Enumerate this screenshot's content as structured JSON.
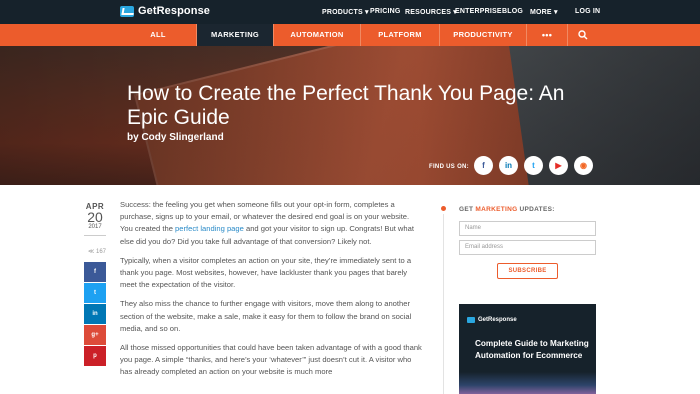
{
  "topbar": {
    "brand": "GetResponse",
    "links": [
      "PRODUCTS ▾",
      "PRICING",
      "RESOURCES ▾",
      "ENTERPRISE",
      "BLOG",
      "MORE ▾"
    ],
    "login": "LOG IN"
  },
  "mainnav": {
    "items": [
      "ALL",
      "MARKETING",
      "AUTOMATION",
      "PLATFORM",
      "PRODUCTIVITY",
      "•••"
    ],
    "active": "MARKETING"
  },
  "hero": {
    "title": "How to Create the Perfect Thank You Page: An Epic Guide",
    "author": "by Cody Slingerland",
    "find_us": "FIND US ON:",
    "social": [
      {
        "icon": "facebook-icon",
        "glyph": "f",
        "color": "#3b5998"
      },
      {
        "icon": "linkedin-icon",
        "glyph": "in",
        "color": "#0077b5"
      },
      {
        "icon": "twitter-icon",
        "glyph": "t",
        "color": "#1da1f2"
      },
      {
        "icon": "youtube-icon",
        "glyph": "▶",
        "color": "#e52d27"
      },
      {
        "icon": "rss-icon",
        "glyph": "◉",
        "color": "#f26522"
      }
    ]
  },
  "post": {
    "month": "APR",
    "day": "20",
    "year": "2017",
    "share_count": "≪ 167",
    "share_buttons": [
      {
        "icon": "facebook-icon",
        "glyph": "f",
        "color": "#3b5998"
      },
      {
        "icon": "twitter-icon",
        "glyph": "t",
        "color": "#1da1f2"
      },
      {
        "icon": "linkedin-icon",
        "glyph": "in",
        "color": "#0077b5"
      },
      {
        "icon": "google-plus-icon",
        "glyph": "g+",
        "color": "#dd4b39"
      },
      {
        "icon": "pinterest-icon",
        "glyph": "p",
        "color": "#cb2027"
      }
    ],
    "p1_a": "Success: the feeling you get when someone fills out your opt-in form, completes a purchase, signs up to your email, or whatever the desired end goal is on your website. You created the ",
    "p1_link": "perfect landing page",
    "p1_b": " and got your visitor to sign up. Congrats! But what else did you do? Did you take full advantage of that conversion? Likely not.",
    "p2": "Typically, when a visitor completes an action on your site, they’re immediately sent to a thank you page. Most websites, however, have lackluster thank you pages that barely meet the expectation of the visitor.",
    "p3": "They also miss the chance to further engage with visitors, move them along to another section of the website, make a sale, make it easy for them to follow the brand on social media, and so on.",
    "p4": "All those missed opportunities that could have been taken advantage of with a good thank you page. A simple “thanks, and here’s your ‘whatever’” just doesn’t cut it. A visitor who has already completed an action on your website is much more"
  },
  "sidebar": {
    "heading_pre": "GET",
    "heading_accent": "MARKETING",
    "heading_post": "UPDATES:",
    "name_placeholder": "Name",
    "email_placeholder": "Email address",
    "subscribe": "SUBSCRIBE",
    "ad_brand": "GetResponse",
    "ad_headline": "Complete Guide to Marketing Automation for Ecommerce"
  },
  "colors": {
    "accent": "#ec5c2c",
    "dark": "#16222b",
    "link": "#2a8bc8"
  }
}
